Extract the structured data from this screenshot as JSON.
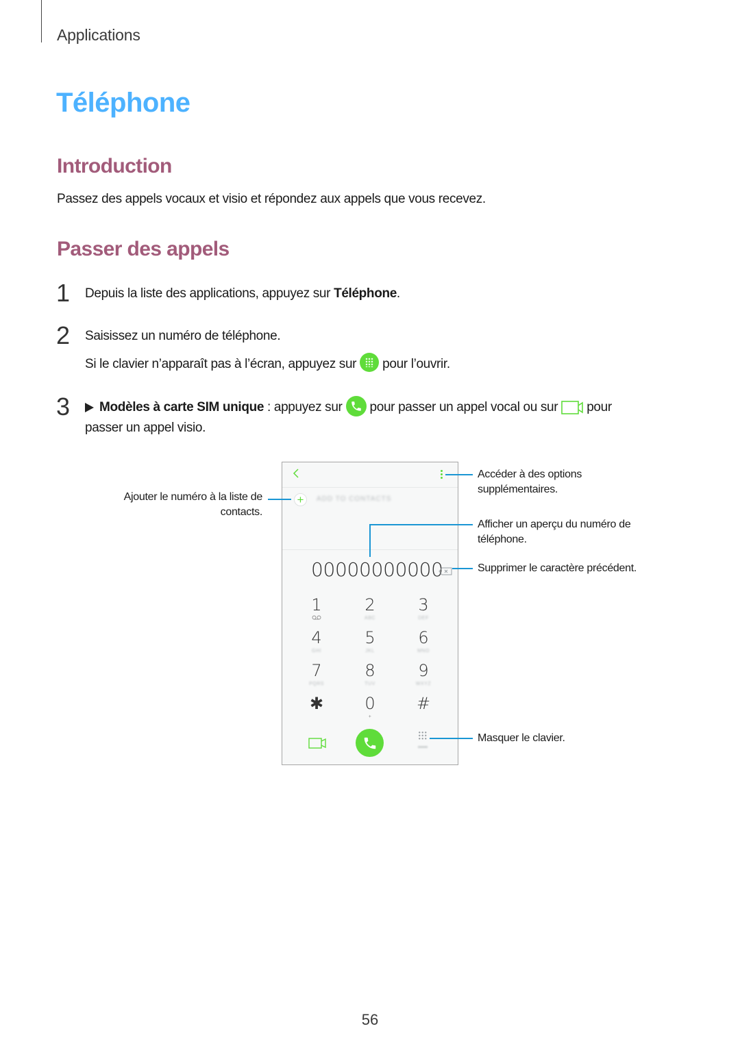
{
  "header": {
    "section": "Applications"
  },
  "title": "Téléphone",
  "introduction": {
    "heading": "Introduction",
    "text": "Passez des appels vocaux et visio et répondez aux appels que vous recevez."
  },
  "passer_des_appels": {
    "heading": "Passer des appels",
    "steps": [
      {
        "number": "1",
        "text_before": "Depuis la liste des applications, appuyez sur ",
        "bold": "Téléphone",
        "text_after": "."
      },
      {
        "number": "2",
        "text": "Saisissez un numéro de téléphone.",
        "note_before": "Si le clavier n’apparaît pas à l’écran, appuyez sur",
        "note_icon": "keypad-icon",
        "note_after": "pour l’ouvrir."
      },
      {
        "number": "3",
        "bullet_icon": "arrow-right-icon",
        "bold": "Modèles à carte SIM unique",
        "text_a": " : appuyez sur",
        "icon_a": "voice-call-icon",
        "text_b": "pour passer un appel vocal ou sur",
        "icon_b": "video-call-icon",
        "text_c": "pour",
        "line2": "passer un appel visio."
      }
    ]
  },
  "phone_screen": {
    "back_icon": "chevron-left-icon",
    "more_icon": "more-options-icon",
    "add_to_contacts_label": "ADD TO CONTACTS",
    "number": "00000000000",
    "backspace_icon": "backspace-icon",
    "keys": [
      {
        "digit": "1",
        "letters": "voicemail"
      },
      {
        "digit": "2",
        "letters": "ABC"
      },
      {
        "digit": "3",
        "letters": "DEF"
      },
      {
        "digit": "4",
        "letters": "GHI"
      },
      {
        "digit": "5",
        "letters": "JKL"
      },
      {
        "digit": "6",
        "letters": "MNO"
      },
      {
        "digit": "7",
        "letters": "PQRS"
      },
      {
        "digit": "8",
        "letters": "TUV"
      },
      {
        "digit": "9",
        "letters": "WXYZ"
      },
      {
        "digit": "✱",
        "letters": ""
      },
      {
        "digit": "0",
        "letters": "+"
      },
      {
        "digit": "#",
        "letters": ""
      }
    ],
    "hide_label": "HIDE"
  },
  "callouts": {
    "add_contact": "Ajouter le numéro à la liste de contacts.",
    "more_options": "Accéder à des options supplémentaires.",
    "preview": "Afficher un aperçu du numéro de téléphone.",
    "delete": "Supprimer le caractère précédent.",
    "hide_keypad": "Masquer le clavier."
  },
  "colors": {
    "title_blue": "#4db2ff",
    "heading_mauve": "#a25b7a",
    "accent_green": "#5fdc3a",
    "callout_blue": "#1a96d4"
  },
  "page_number": "56"
}
